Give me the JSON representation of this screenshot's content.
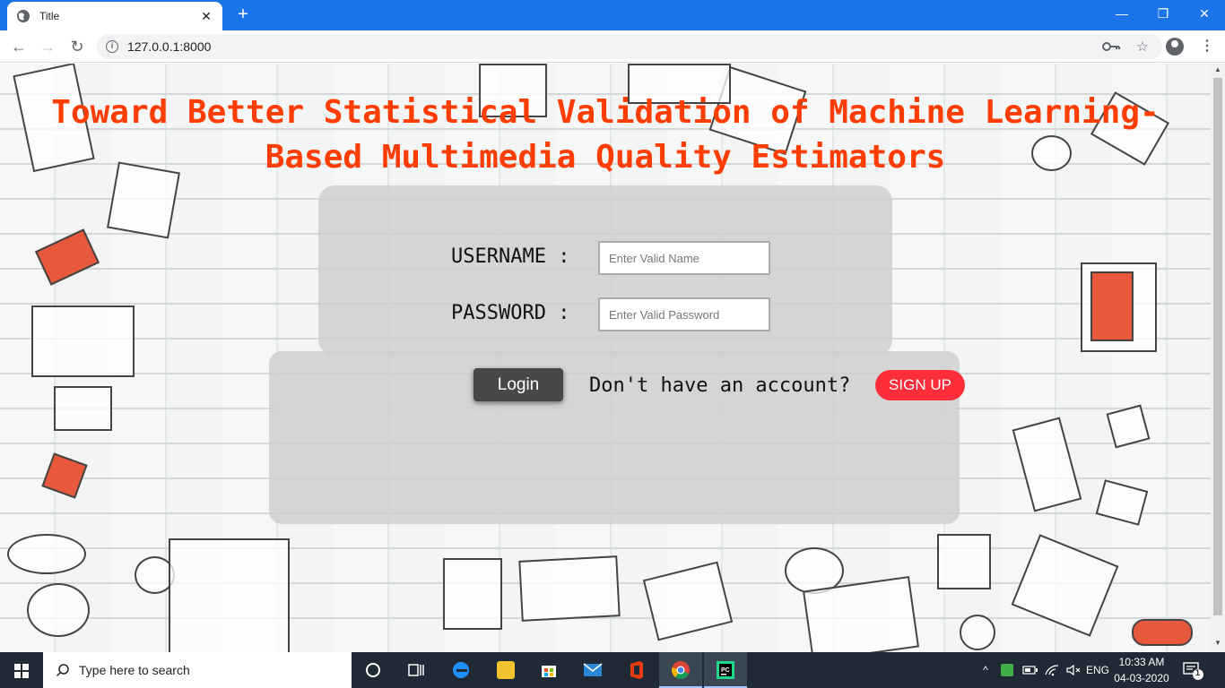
{
  "browser": {
    "tab_title": "Title",
    "tab_close": "✕",
    "new_tab": "+",
    "url": "127.0.0.1:8000",
    "window_controls": {
      "minimize": "—",
      "restore": "❐",
      "close": "✕"
    },
    "nav": {
      "back": "←",
      "forward": "→",
      "reload": "↻"
    },
    "omnibox_icons": {
      "key": "key-icon",
      "star": "☆"
    },
    "menu": "⋮"
  },
  "page": {
    "title": "Toward Better Statistical Validation of Machine Learning-Based Multimedia Quality Estimators",
    "title_color": "#ff3d00",
    "form": {
      "username_label": "USERNAME :",
      "username_placeholder": "Enter Valid Name",
      "password_label": "PASSWORD :",
      "password_placeholder": "Enter Valid Password",
      "login_label": "Login",
      "no_account_text": "Don't have an account?",
      "signup_label": "SIGN UP"
    },
    "colors": {
      "login_bg": "#484848",
      "signup_bg": "#ff2e3a"
    }
  },
  "taskbar": {
    "search_placeholder": "Type here to search",
    "language": "ENG",
    "time": "10:33 AM",
    "date": "04-03-2020",
    "notification_count": "1",
    "pinned": [
      "task-view-icon",
      "edge-icon",
      "file-explorer-icon",
      "store-icon",
      "mail-icon",
      "office-icon",
      "chrome-icon",
      "pycharm-icon"
    ]
  }
}
